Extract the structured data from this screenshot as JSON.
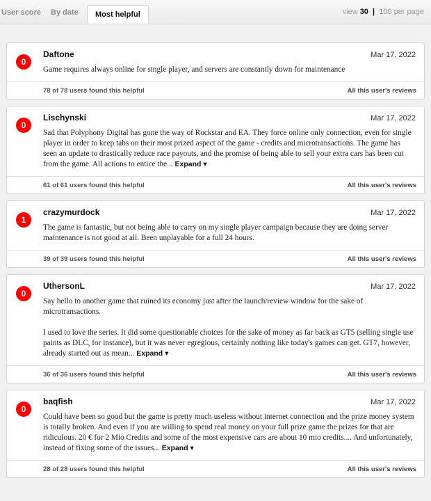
{
  "sort_tabs": {
    "user_score": "User score",
    "by_date": "By date",
    "most_helpful": "Most helpful"
  },
  "per_page": {
    "prefix": "view",
    "selected": "30",
    "separator": "|",
    "other": "100",
    "suffix": "per page"
  },
  "reviews": [
    {
      "score": "0",
      "author": "Daftone",
      "date": "Mar 17, 2022",
      "text": "Game requires always online for single player, and servers are constantly down for maintenance",
      "expand": "",
      "helpful": "78 of 78 users found this helpful",
      "all_reviews": "All this user's reviews"
    },
    {
      "score": "0",
      "author": "Lischynski",
      "date": "Mar 17, 2022",
      "text": "Sad that Polyphony Digital has gone the way of Rockstar and EA. They force online only connection, even for single player in order to keep tabs on their most prized aspect of the game - credits and microtransactions. The game has seen an update to drastically reduce race payouts, and the promise of being able to sell your extra cars has been cut from the game. All actions to entice the...",
      "expand": "Expand ▾",
      "helpful": "61 of 61 users found this helpful",
      "all_reviews": "All this user's reviews"
    },
    {
      "score": "1",
      "author": "crazymurdock",
      "date": "Mar 17, 2022",
      "text": "The game is fantastic, but not being able to carry on my single player campaign because they are doing server maintenance is not good at all. Been unplayable for a full 24 hours.",
      "expand": "",
      "helpful": "39 of 39 users found this helpful",
      "all_reviews": "All this user's reviews"
    },
    {
      "score": "0",
      "author": "UthersonL",
      "date": "Mar 17, 2022",
      "text": "Say hello to another game that ruined its economy just after the launch/review window for the sake of microtransactions.\n\nI used to love the series. It did some questionable choices for the sake of money as far back as GT5 (selling single use paints as DLC, for instance), but it was never egregious, certainly nothing like today's games can get. GT7, however, already started out as mean...",
      "expand": "Expand ▾",
      "helpful": "36 of 36 users found this helpful",
      "all_reviews": "All this user's reviews"
    },
    {
      "score": "0",
      "author": "baqfish",
      "date": "Mar 17, 2022",
      "text": "Could have been so good but the game is pretty much useless without internet connection and the prize money system is totally broken. And even if you are willing to spend real money on your full prize game the prizes for that are ridiculous. 20 € for 2 Mio Credits and some of the most expensive cars are about 10 mio credits.... And unfortunately, instead of fixing some of the issues...",
      "expand": "Expand ▾",
      "helpful": "28 of 28 users found this helpful",
      "all_reviews": "All this user's reviews"
    }
  ],
  "colors": {
    "score_negative": "#ff0000",
    "background": "#f1f1f1"
  }
}
